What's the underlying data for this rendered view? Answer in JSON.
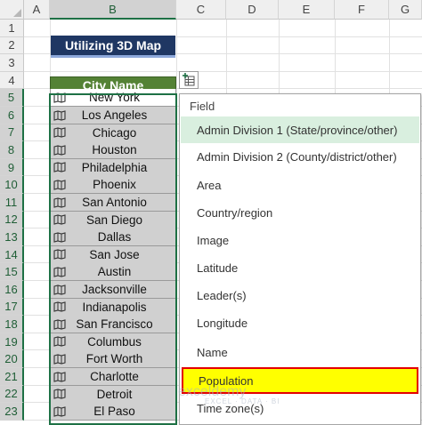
{
  "sheet": {
    "columns": [
      "A",
      "B",
      "C",
      "D",
      "E",
      "F",
      "G"
    ],
    "rows": [
      "1",
      "2",
      "3",
      "4",
      "5",
      "6",
      "7",
      "8",
      "9",
      "10",
      "11",
      "12",
      "13",
      "14",
      "15",
      "16",
      "17",
      "18",
      "19",
      "20",
      "21",
      "22",
      "23"
    ],
    "title": "Utilizing 3D Map",
    "header": "City Name",
    "cities": [
      "New York",
      "Los Angeles",
      "Chicago",
      "Houston",
      "Philadelphia",
      "Phoenix",
      "San Antonio",
      "San Diego",
      "Dallas",
      "San Jose",
      "Austin",
      "Jacksonville",
      "Indianapolis",
      "San Francisco",
      "Columbus",
      "Fort Worth",
      "Charlotte",
      "Detroit",
      "El Paso"
    ]
  },
  "field_menu": {
    "title": "Field",
    "items": [
      {
        "label": "Admin Division 1 (State/province/other)",
        "state": "hover"
      },
      {
        "label": "Admin Division 2 (County/district/other)",
        "state": ""
      },
      {
        "label": "Area",
        "state": ""
      },
      {
        "label": "Country/region",
        "state": ""
      },
      {
        "label": "Image",
        "state": ""
      },
      {
        "label": "Latitude",
        "state": ""
      },
      {
        "label": "Leader(s)",
        "state": ""
      },
      {
        "label": "Longitude",
        "state": ""
      },
      {
        "label": "Name",
        "state": ""
      },
      {
        "label": "Population",
        "state": "highlighted"
      },
      {
        "label": "Time zone(s)",
        "state": ""
      }
    ]
  },
  "watermark": {
    "brand": "exceldemy",
    "tagline": "EXCEL · DATA · BI"
  },
  "colors": {
    "title_bg": "#1f3763",
    "header_bg": "#548235",
    "highlight": "#ffff00",
    "highlight_border": "#e30000",
    "hover": "#d9efdf"
  }
}
